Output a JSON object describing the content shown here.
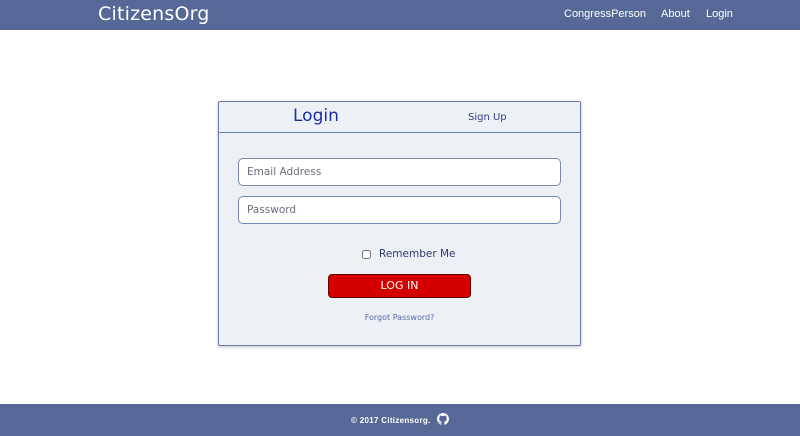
{
  "navbar": {
    "brand": "CitizensOrg",
    "links": [
      {
        "label": "CongressPerson"
      },
      {
        "label": "About"
      },
      {
        "label": "Login"
      }
    ]
  },
  "card": {
    "tabs": {
      "login": "Login",
      "signup": "Sign Up"
    },
    "email": {
      "placeholder": "Email Address",
      "value": ""
    },
    "password": {
      "placeholder": "Password",
      "value": ""
    },
    "remember": {
      "label": "Remember Me",
      "checked": false
    },
    "login_button": "LOG IN",
    "forgot": "Forgot Password?"
  },
  "footer": {
    "copyright": "© 2017 Citizensorg.",
    "icon": "github-icon"
  },
  "colors": {
    "navbar": "#566996",
    "card_bg": "#edf1f6",
    "button": "#d40000",
    "tab_active": "#1a2aa5"
  }
}
